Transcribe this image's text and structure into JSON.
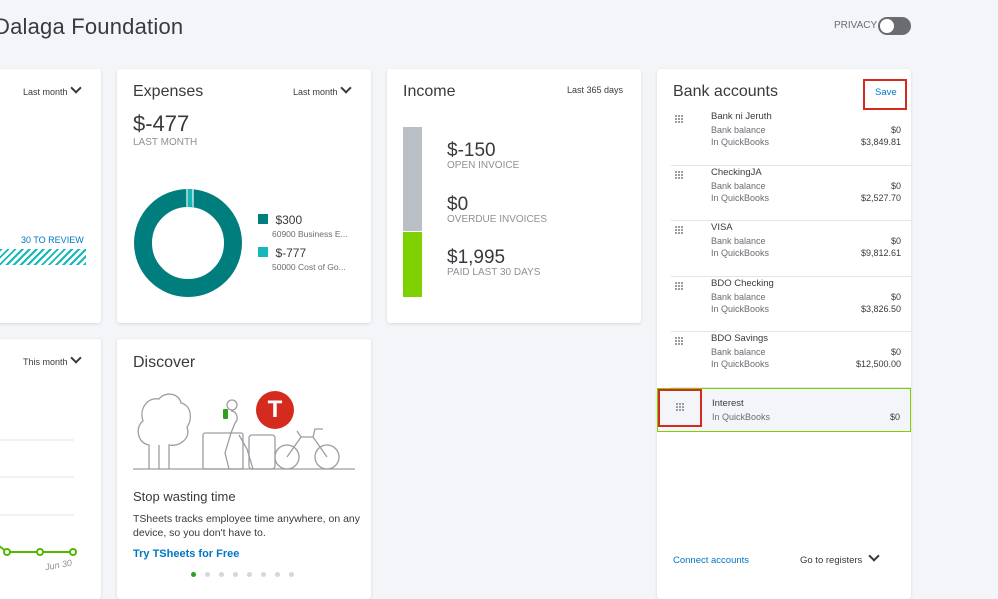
{
  "header": {
    "company_name": "Dalaga Foundation",
    "privacy_label": "PRIVACY"
  },
  "left_card": {
    "period": "Last month",
    "review_link": "30 TO REVIEW"
  },
  "left_card_bottom": {
    "period": "This month",
    "x_tick": "Jun 30",
    "colors": {
      "line": "#53b700"
    }
  },
  "expenses": {
    "title": "Expenses",
    "period": "Last month",
    "total": "$-477",
    "total_label": "LAST MONTH",
    "chart_data": {
      "type": "pie",
      "labels": [
        "60900 Business E...",
        "50000 Cost of Go..."
      ],
      "values": [
        300,
        -777
      ],
      "colors": [
        "#007e7e",
        "#14b8b8"
      ]
    },
    "legend": [
      {
        "value": "$300",
        "desc": "60900 Business E..."
      },
      {
        "value": "$-777",
        "desc": "50000 Cost of Go..."
      }
    ]
  },
  "income": {
    "title": "Income",
    "period": "Last 365 days",
    "open_value": "$-150",
    "open_label": "OPEN INVOICE",
    "overdue_value": "$0",
    "overdue_label": "OVERDUE INVOICES",
    "paid_value": "$1,995",
    "paid_label": "PAID LAST 30 DAYS",
    "colors": {
      "open": "#babec5",
      "paid": "#7fd000"
    }
  },
  "bank_accounts": {
    "title": "Bank accounts",
    "save_label": "Save",
    "bank_balance_label": "Bank balance",
    "in_qb_label": "In QuickBooks",
    "accounts": [
      {
        "name": "Bank ni Jeruth",
        "bank_balance": "$0",
        "in_qb": "$3,849.81"
      },
      {
        "name": "CheckingJA",
        "bank_balance": "$0",
        "in_qb": "$2,527.70"
      },
      {
        "name": "VISA",
        "bank_balance": "$0",
        "in_qb": "$9,812.61"
      },
      {
        "name": "BDO Checking",
        "bank_balance": "$0",
        "in_qb": "$3,826.50"
      },
      {
        "name": "BDO Savings",
        "bank_balance": "$0",
        "in_qb": "$12,500.00"
      },
      {
        "name": "Interest",
        "in_qb": "$0"
      }
    ],
    "connect_label": "Connect accounts",
    "registers_label": "Go to registers"
  },
  "discover": {
    "title": "Discover",
    "headline": "Stop wasting time",
    "body": "TSheets tracks employee time anywhere, on any device, so you don't have to.",
    "cta": "Try TSheets for Free",
    "badge_letter": "T",
    "carousel": {
      "count": 8,
      "active": 1
    }
  }
}
